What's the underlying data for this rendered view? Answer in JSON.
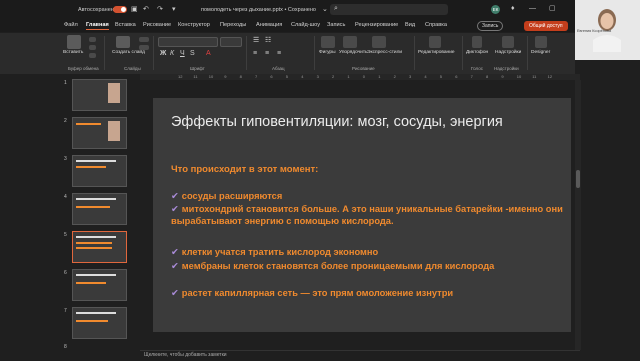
{
  "titlebar": {
    "autosave_label": "Автосохранение",
    "doc_title": "помолодеть через дыхание.pptx • Сохранено"
  },
  "menu": {
    "items": [
      "Файл",
      "Главная",
      "Вставка",
      "Рисование",
      "Конструктор",
      "Переходы",
      "Анимация",
      "Слайд-шоу",
      "Запись",
      "Рецензирование",
      "Вид",
      "Справка"
    ],
    "record": "Запись",
    "share": "Общий доступ"
  },
  "ribbon": {
    "paste": "Вставить",
    "create_slide": "Создать слайд",
    "figures": "Фигуры",
    "arrange": "Упорядочить",
    "express_styles": "Экспресс-стили",
    "editing": "Редактирование",
    "dictation": "Диктофон",
    "addins": "Надстройки",
    "designer": "Designer",
    "groups": {
      "clipboard": "Буфер обмена",
      "slides": "Слайды",
      "font": "Шрифт",
      "paragraph": "Абзац",
      "drawing": "Рисование",
      "voice": "Голос",
      "addins": "Надстройки"
    }
  },
  "webcam": {
    "name": "Евгения Ксорёнова"
  },
  "ruler": {
    "ticks": [
      "12",
      "11",
      "10",
      "9",
      "8",
      "7",
      "6",
      "5",
      "4",
      "3",
      "2",
      "1",
      "0",
      "1",
      "2",
      "3",
      "4",
      "5",
      "6",
      "7",
      "8",
      "9",
      "10",
      "11",
      "12"
    ]
  },
  "thumbnails": {
    "numbers": [
      "1",
      "2",
      "3",
      "4",
      "5",
      "6",
      "7",
      "8"
    ],
    "selected": "5"
  },
  "slide": {
    "title": "Эффекты гиповентиляции: мозг, сосуды, энергия",
    "subtitle": "Что происходит в этот момент:",
    "bullets": [
      "сосуды расширяются",
      "митохондрий становится больше. А это наши уникальные батарейки -именно они вырабатывают энергию с помощью кислорода.",
      "клетки учатся тратить кислород экономно",
      "мембраны клеток становятся более проницаемыми для кислорода",
      "растет капиллярная сеть — это прям омоложение изнутри"
    ]
  },
  "notes": {
    "placeholder": "Щелкните, чтобы добавить заметки"
  },
  "colors": {
    "accent": "#c43e1c",
    "bullet_text": "#f08a2e",
    "check": "#a98bd8"
  }
}
